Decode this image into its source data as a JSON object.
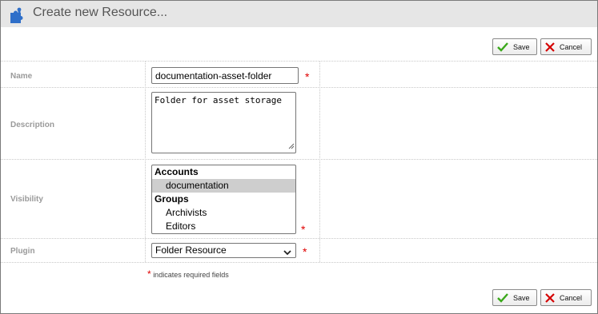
{
  "window": {
    "title": "Create new Resource..."
  },
  "toolbar": {
    "save_label": "Save",
    "cancel_label": "Cancel"
  },
  "form": {
    "name": {
      "label": "Name",
      "value": "documentation-asset-folder"
    },
    "description": {
      "label": "Description",
      "value": "Folder for asset storage"
    },
    "visibility": {
      "label": "Visibility",
      "groups": [
        {
          "label": "Accounts",
          "options": [
            {
              "label": "documentation",
              "selected": true
            }
          ]
        },
        {
          "label": "Groups",
          "options": [
            {
              "label": "Archivists",
              "selected": false
            },
            {
              "label": "Editors",
              "selected": false
            }
          ]
        }
      ]
    },
    "plugin": {
      "label": "Plugin",
      "value": "Folder Resource"
    }
  },
  "required_marker": "*",
  "required_note": "indicates required fields",
  "colors": {
    "required": "#e00000",
    "save_check": "#3aa81a",
    "cancel_x": "#d40000",
    "selected_option": "#cecece",
    "titlebar": "#e6e6e6"
  },
  "icons": {
    "title": "puzzle-piece-icon",
    "save": "checkmark-icon",
    "cancel": "x-icon",
    "select": "chevron-down-icon"
  }
}
